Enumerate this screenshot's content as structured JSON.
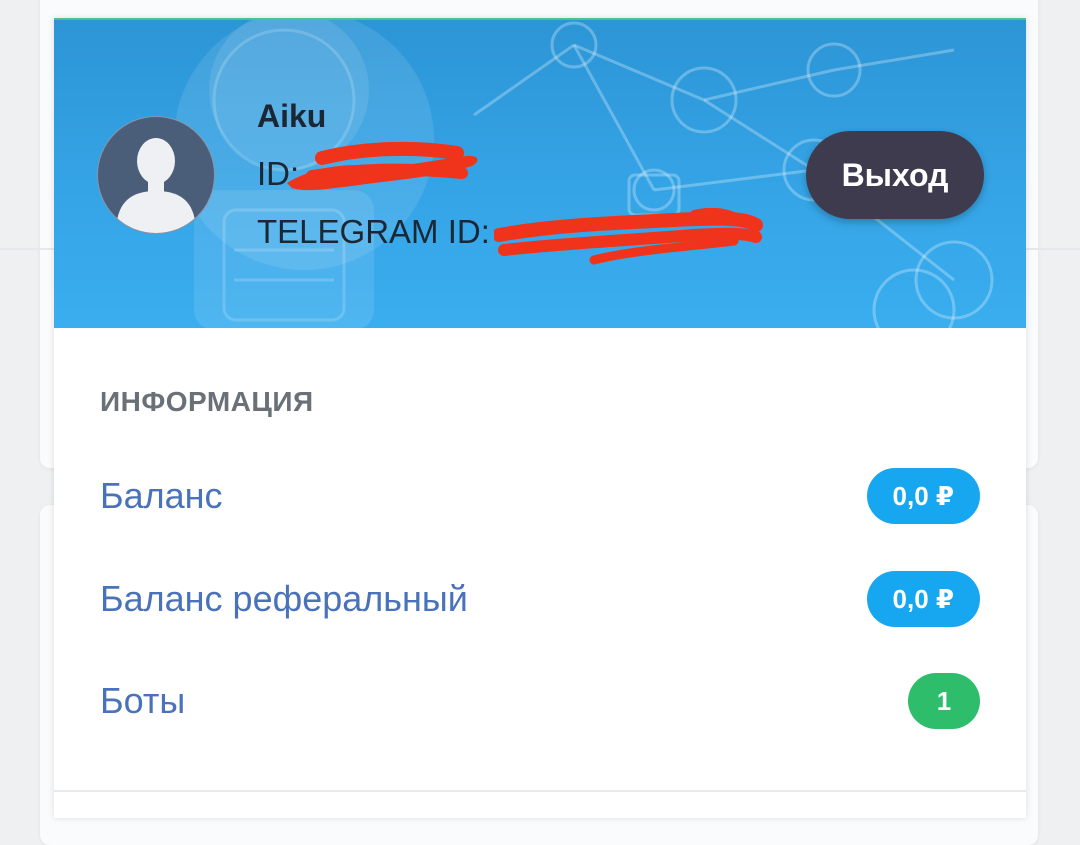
{
  "profile": {
    "name": "Aiku",
    "id_label": "ID:",
    "telegram_label": "TELEGRAM ID:",
    "logout_label": "Выход",
    "avatar_icon": "user-silhouette-icon"
  },
  "info": {
    "title": "ИНФОРМАЦИЯ",
    "rows": [
      {
        "label": "Баланс",
        "value": "0,0 ₽"
      },
      {
        "label": "Баланс реферальный",
        "value": "0,0 ₽"
      },
      {
        "label": "Боты",
        "value": "1"
      }
    ]
  },
  "colors": {
    "header_blue": "#35a4e6",
    "logout_button": "#3d3b4d",
    "badge_blue": "#17a7f0",
    "badge_green": "#2ebd6b",
    "label_blue": "#4a72ba",
    "redaction_red": "#f0341c"
  }
}
